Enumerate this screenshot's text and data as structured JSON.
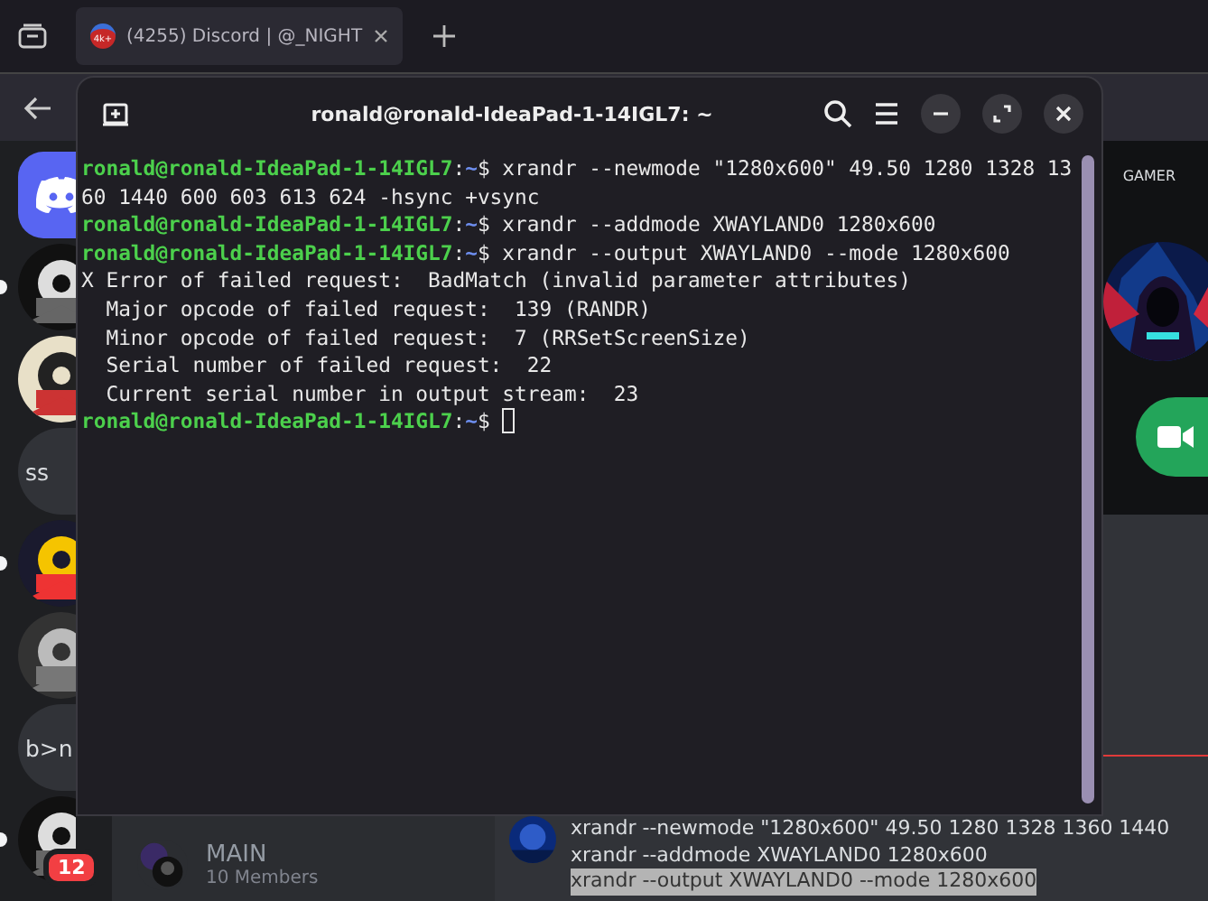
{
  "browser": {
    "tabs": [
      {
        "title": "(4255) Discord | @_NIGHT",
        "favicon_badge": "4k+",
        "selected": true
      }
    ]
  },
  "discord": {
    "servers": [
      {
        "kind": "logo",
        "selected": true,
        "unread": false
      },
      {
        "kind": "picture",
        "selected": false,
        "unread": true
      },
      {
        "kind": "picture",
        "selected": false,
        "unread": false
      },
      {
        "kind": "text",
        "label": "ss",
        "selected": false,
        "unread": false
      },
      {
        "kind": "picture",
        "selected": false,
        "unread": true
      },
      {
        "kind": "picture",
        "selected": false,
        "unread": false
      },
      {
        "kind": "text",
        "label": "b>n",
        "selected": false,
        "unread": false
      },
      {
        "kind": "picture",
        "selected": false,
        "unread": true,
        "badge": "12"
      }
    ],
    "channel": {
      "name": "MAIN",
      "members": "10 Members"
    },
    "profile": {
      "name": "GAMER"
    },
    "messages": [
      {
        "text": "xrandr --newmode \"1280x600\" 49.50 1280 1328 1360 1440",
        "selected": false
      },
      {
        "text": "xrandr --addmode XWAYLAND0 1280x600",
        "selected": false
      },
      {
        "text": "xrandr --output XWAYLAND0 --mode 1280x600",
        "selected": true
      }
    ]
  },
  "terminal": {
    "title": "ronald@ronald-IdeaPad-1-14IGL7: ~",
    "lines": [
      {
        "kind": "prompt",
        "user": "ronald@ronald-IdeaPad-1-14IGL7",
        "separator": ":",
        "path": "~",
        "sign": "$",
        "command": "xrandr --newmode \"1280x600\" 49.50 1280 1328 1360 1440 600 603 613 624 -hsync +vsync"
      },
      {
        "kind": "prompt",
        "user": "ronald@ronald-IdeaPad-1-14IGL7",
        "separator": ":",
        "path": "~",
        "sign": "$",
        "command": "xrandr --addmode XWAYLAND0 1280x600"
      },
      {
        "kind": "prompt",
        "user": "ronald@ronald-IdeaPad-1-14IGL7",
        "separator": ":",
        "path": "~",
        "sign": "$",
        "command": "xrandr --output XWAYLAND0 --mode 1280x600"
      },
      {
        "kind": "output",
        "text": "X Error of failed request:  BadMatch (invalid parameter attributes)"
      },
      {
        "kind": "output",
        "text": "  Major opcode of failed request:  139 (RANDR)"
      },
      {
        "kind": "output",
        "text": "  Minor opcode of failed request:  7 (RRSetScreenSize)"
      },
      {
        "kind": "output",
        "text": "  Serial number of failed request:  22"
      },
      {
        "kind": "output",
        "text": "  Current serial number in output stream:  23"
      },
      {
        "kind": "prompt",
        "user": "ronald@ronald-IdeaPad-1-14IGL7",
        "separator": ":",
        "path": "~",
        "sign": "$",
        "cursor": true
      }
    ]
  }
}
